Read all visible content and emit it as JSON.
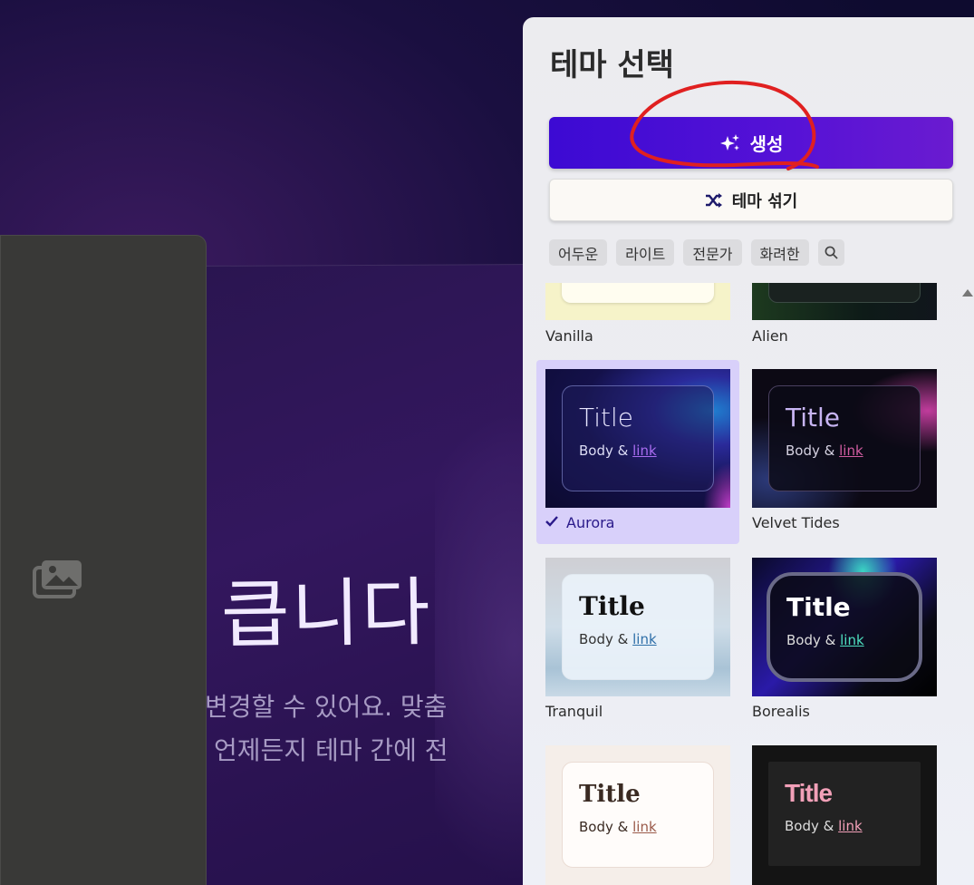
{
  "canvas": {
    "slide_title": "큽니다",
    "slide_line_1": "변경할 수 있어요. 맞춤",
    "slide_line_2": "언제든지 테마 간에 전"
  },
  "panel": {
    "title": "테마 선택",
    "generate_label": "생성",
    "shuffle_label": "테마 섞기",
    "filters": [
      "어두운",
      "라이트",
      "전문가",
      "화려한"
    ]
  },
  "themes": [
    {
      "name": "Vanilla",
      "selected": false
    },
    {
      "name": "Alien",
      "selected": false
    },
    {
      "name": "Aurora",
      "selected": true,
      "title": "Title",
      "body": "Body &",
      "link": "link"
    },
    {
      "name": "Velvet Tides",
      "selected": false,
      "title": "Title",
      "body": "Body &",
      "link": "link"
    },
    {
      "name": "Tranquil",
      "selected": false,
      "title": "Title",
      "body": "Body &",
      "link": "link"
    },
    {
      "name": "Borealis",
      "selected": false,
      "title": "Title",
      "body": "Body &",
      "link": "link"
    },
    {
      "name": "",
      "selected": false,
      "title": "Title",
      "body": "Body &",
      "link": "link"
    },
    {
      "name": "",
      "selected": false,
      "title": "Title",
      "body": "Body &",
      "link": "link"
    }
  ],
  "colors": {
    "generate_button": "#4b10d6",
    "selected_card": "#d8d0fa",
    "annotation": "#e02020"
  }
}
